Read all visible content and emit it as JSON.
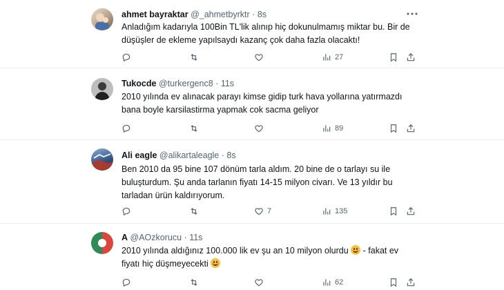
{
  "tweets": [
    {
      "name": "ahmet bayraktar",
      "handle": "@_ahmetbyrktr",
      "time": "8s",
      "lines": [
        "Anladığım kadarıyla 100Bin TL'lik alınıp hiç dokunulmamış miktar bu. Bir de",
        "düşüşler de ekleme yapılsaydı kazanç çok daha fazla olacaktı!"
      ],
      "views": "27",
      "likes": "",
      "avatar_colors": [
        "#d9c7b3",
        "#7c6a5a"
      ]
    },
    {
      "name": "Tukocde",
      "handle": "@turkergenc8",
      "time": "11s",
      "lines": [
        "2010 yılında ev alınacak parayı kimse gidip turk hava yollarına yatırmazdı",
        "bana boyle karsilastirma yapmak cok sacma geliyor"
      ],
      "views": "89",
      "likes": "",
      "avatar_colors": [
        "#3b3b3b",
        "#c9c9c9"
      ]
    },
    {
      "name": "Ali eagle",
      "handle": "@alikartaleagle",
      "time": "8s",
      "lines": [
        "Ben 2010 da 95 bine 107 dönüm  tarla aldım. 20 bine de o tarlayı su ile",
        "buluşturdum. Şu anda tarlanın fiyatı 14-15 milyon civarı. Ve 13 yıldır bu",
        "tarladan ürün kaldırıyorum."
      ],
      "views": "135",
      "likes": "7",
      "avatar_colors": [
        "#2f4f7f",
        "#8fb0d8"
      ]
    },
    {
      "name": "A",
      "handle": "@AOzkorucu",
      "time": "11s",
      "lines": [
        "2010 yılında aldığınız 100.000 lik  ev şu an 10 milyon olurdu",
        "fiyatı hiç düşmeyecekti"
      ],
      "line_suffixes": [
        " - fakat ev",
        ""
      ],
      "views": "62",
      "likes": "",
      "avatar_colors": [
        "#2e8b57",
        "#d9473f"
      ]
    }
  ],
  "separator": "·",
  "icons": {
    "reply": "reply-icon",
    "retweet": "retweet-icon",
    "like": "heart-icon",
    "views": "views-icon",
    "bookmark": "bookmark-icon",
    "share": "share-icon",
    "more": "more-icon",
    "emoji": "grinning-emoji-icon"
  }
}
